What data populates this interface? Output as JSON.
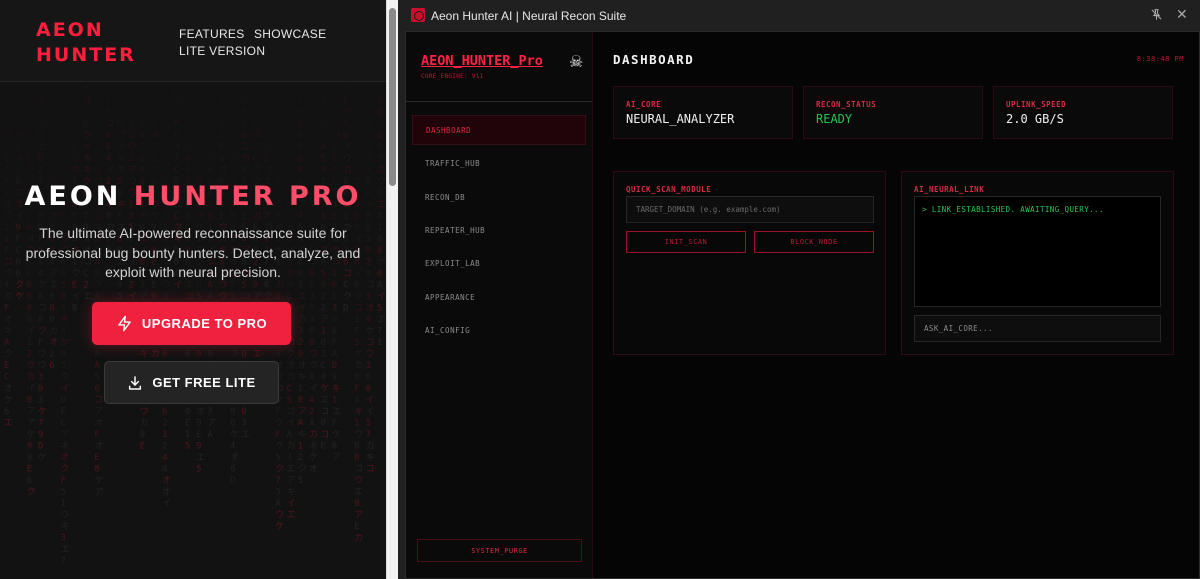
{
  "website": {
    "logo_line1": "AEON",
    "logo_line2": "HUNTER",
    "nav": {
      "features": "FEATURES",
      "showcase": "SHOWCASE",
      "lite_version": "LITE VERSION"
    },
    "hero": {
      "title_part1": "AEON ",
      "title_part2": "HUNTER PRO",
      "subtitle": "The ultimate AI-powered reconnaissance suite for professional bug bounty hunters. Detect, analyze, and exploit with neural precision."
    },
    "buttons": {
      "upgrade": "UPGRADE TO PRO",
      "get_lite": "GET FREE LITE"
    }
  },
  "window": {
    "title": "Aeon Hunter AI | Neural Recon Suite",
    "pin_icon": "pin-icon"
  },
  "sidebar": {
    "brand": "AEON_HUNTER_Pro",
    "brand_icon": "skull-crossbones-icon",
    "engine": "CORE_ENGINE: V11",
    "items": [
      {
        "label": "DASHBOARD",
        "active": true
      },
      {
        "label": "TRAFFIC_HUB",
        "active": false
      },
      {
        "label": "RECON_DB",
        "active": false
      },
      {
        "label": "REPEATER_HUB",
        "active": false
      },
      {
        "label": "EXPLOIT_LAB",
        "active": false
      },
      {
        "label": "APPEARANCE",
        "active": false
      },
      {
        "label": "AI_CONFIG",
        "active": false
      }
    ],
    "purge_label": "SYSTEM_PURGE"
  },
  "main": {
    "title": "DASHBOARD",
    "clock": "8:38:48 PM",
    "stats": [
      {
        "label": "AI_CORE",
        "value": "NEURAL_ANALYZER"
      },
      {
        "label": "RECON_STATUS",
        "value": "READY"
      },
      {
        "label": "UPLINK_SPEED",
        "value": "2.0 GB/S"
      }
    ],
    "quick_scan": {
      "label": "QUICK_SCAN_MODULE",
      "placeholder": "TARGET_DOMAIN (e.g. example.com)",
      "init_label": "INIT_SCAN",
      "block_label": "BLOCK_NODE"
    },
    "neural_link": {
      "label": "AI_NEURAL_LINK",
      "log": "> LINK_ESTABLISHED. AWAITING_QUERY...",
      "ask_placeholder": "ASK_AI_CORE..."
    }
  },
  "colors": {
    "accent": "#ff1e3c",
    "button_red": "#f0213f",
    "status_green": "#23c552",
    "app_bg": "#050505"
  }
}
